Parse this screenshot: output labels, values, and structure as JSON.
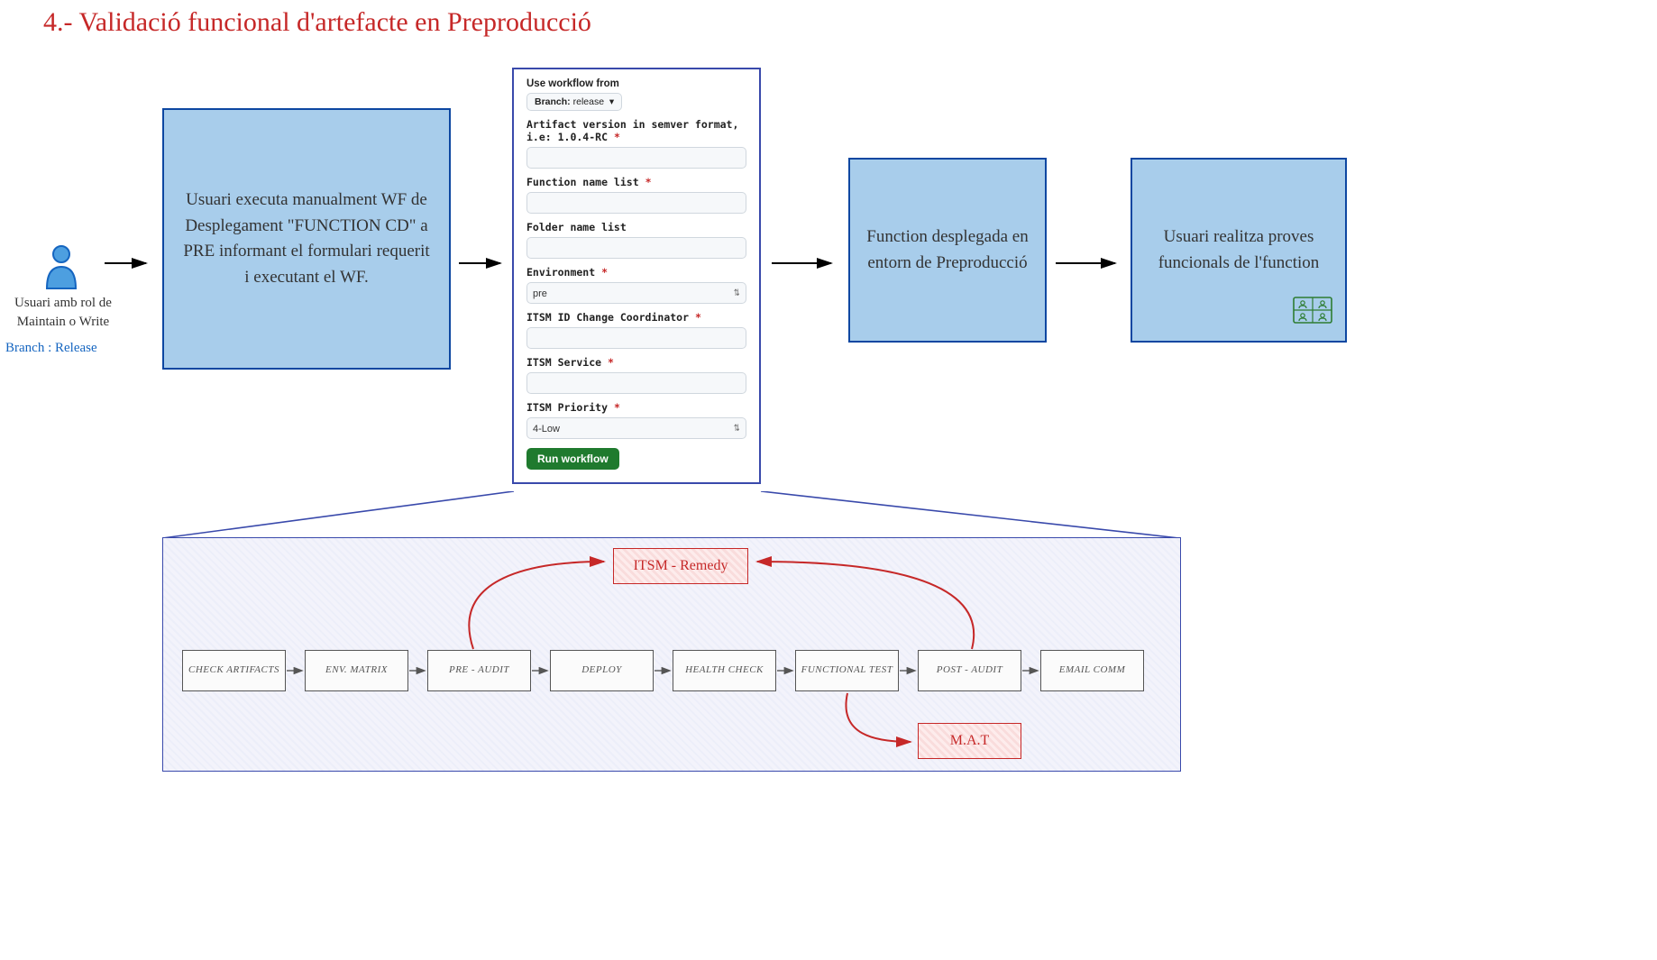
{
  "title": "4.- Validació funcional d'artefacte en Preproducció",
  "user": {
    "line1": "Usuari amb rol de",
    "line2": "Maintain o Write",
    "branch": "Branch : Release"
  },
  "box1": "Usuari executa manualment WF de Desplegament \"FUNCTION CD\" a PRE informant el formulari requerit i executant el WF.",
  "box2": "Function desplegada en entorn de Preproducció",
  "box3": "Usuari realitza proves funcionals de l'function",
  "form": {
    "top": "Use workflow from",
    "branch_label": "Branch:",
    "branch_value": "release",
    "f_artifact_label": "Artifact version in semver format, i.e: 1.0.4-RC",
    "f_fnlist_label": "Function name list",
    "f_folder_label": "Folder name list",
    "f_env_label": "Environment",
    "f_env_value": "pre",
    "f_itsm_cc_label": "ITSM ID Change Coordinator",
    "f_itsm_svc_label": "ITSM Service",
    "f_itsm_prio_label": "ITSM Priority",
    "f_itsm_prio_value": "4-Low",
    "run_btn": "Run workflow"
  },
  "pipeline": {
    "steps": [
      "CHECK ARTIFACTS",
      "ENV. MATRIX",
      "PRE - AUDIT",
      "DEPLOY",
      "HEALTH CHECK",
      "FUNCTIONAL TEST",
      "POST - AUDIT",
      "EMAIL COMM"
    ],
    "itsm": "ITSM - Remedy",
    "mat": "M.A.T"
  }
}
